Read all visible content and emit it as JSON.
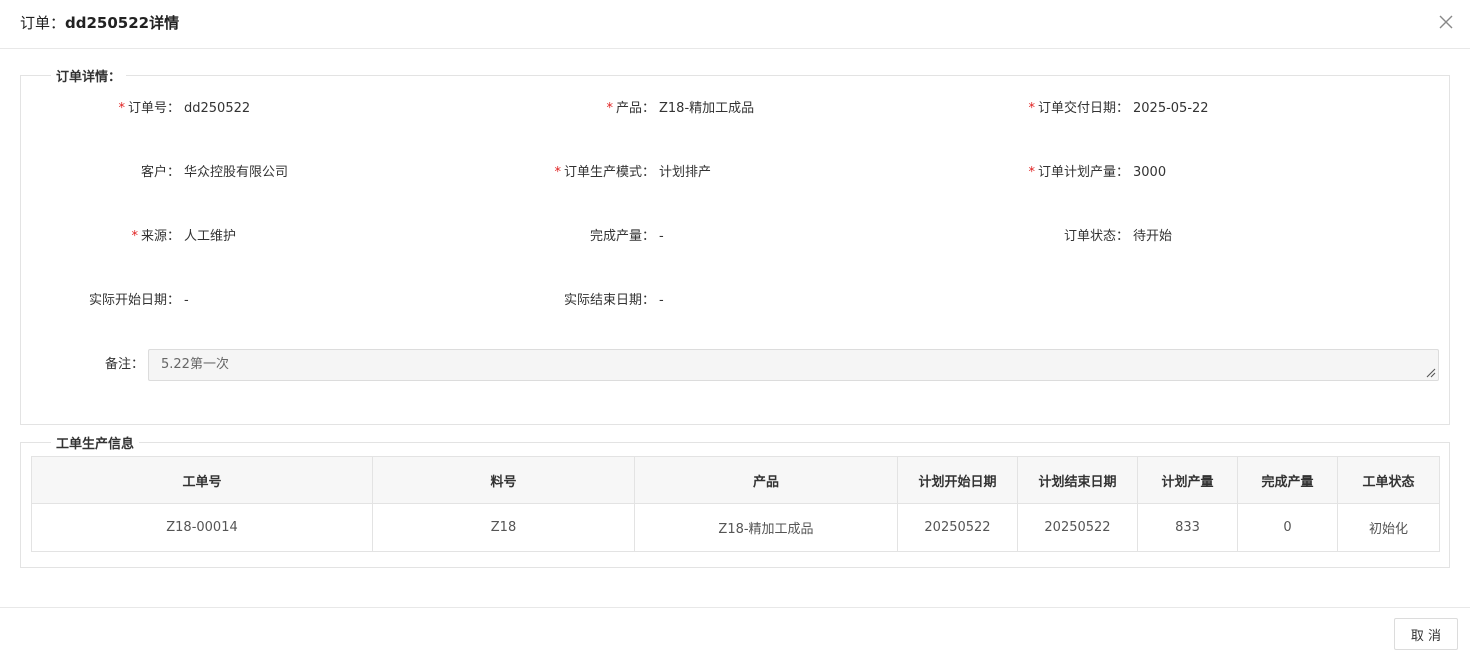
{
  "dialog": {
    "title_prefix": "订单：",
    "title_highlight": "dd250522详情",
    "cancel_label": "取 消"
  },
  "order_section": {
    "legend": "订单详情：",
    "required_mark": "*",
    "fields": {
      "order_no": {
        "label": "订单号：",
        "value": "dd250522"
      },
      "product": {
        "label": "产品：",
        "value": "Z18-精加工成品"
      },
      "delivery_date": {
        "label": "订单交付日期：",
        "value": "2025-05-22"
      },
      "customer": {
        "label": "客户：",
        "value": "华众控股有限公司"
      },
      "production_mode": {
        "label": "订单生产模式：",
        "value": "计划排产"
      },
      "planned_qty": {
        "label": "订单计划产量：",
        "value": "3000"
      },
      "source": {
        "label": "来源：",
        "value": "人工维护"
      },
      "completed_qty": {
        "label": "完成产量：",
        "value": "-"
      },
      "order_status": {
        "label": "订单状态：",
        "value": "待开始"
      },
      "actual_start": {
        "label": "实际开始日期：",
        "value": "-"
      },
      "actual_end": {
        "label": "实际结束日期：",
        "value": "-"
      },
      "remark": {
        "label": "备注：",
        "value": "5.22第一次"
      }
    }
  },
  "work_order_section": {
    "legend": "工单生产信息",
    "columns": [
      "工单号",
      "料号",
      "产品",
      "计划开始日期",
      "计划结束日期",
      "计划产量",
      "完成产量",
      "工单状态"
    ],
    "rows": [
      [
        "Z18-00014",
        "Z18",
        "Z18-精加工成品",
        "20250522",
        "20250522",
        "833",
        "0",
        "初始化"
      ]
    ]
  },
  "icons": {
    "close": "close-icon",
    "resize": "resize-handle-icon"
  }
}
